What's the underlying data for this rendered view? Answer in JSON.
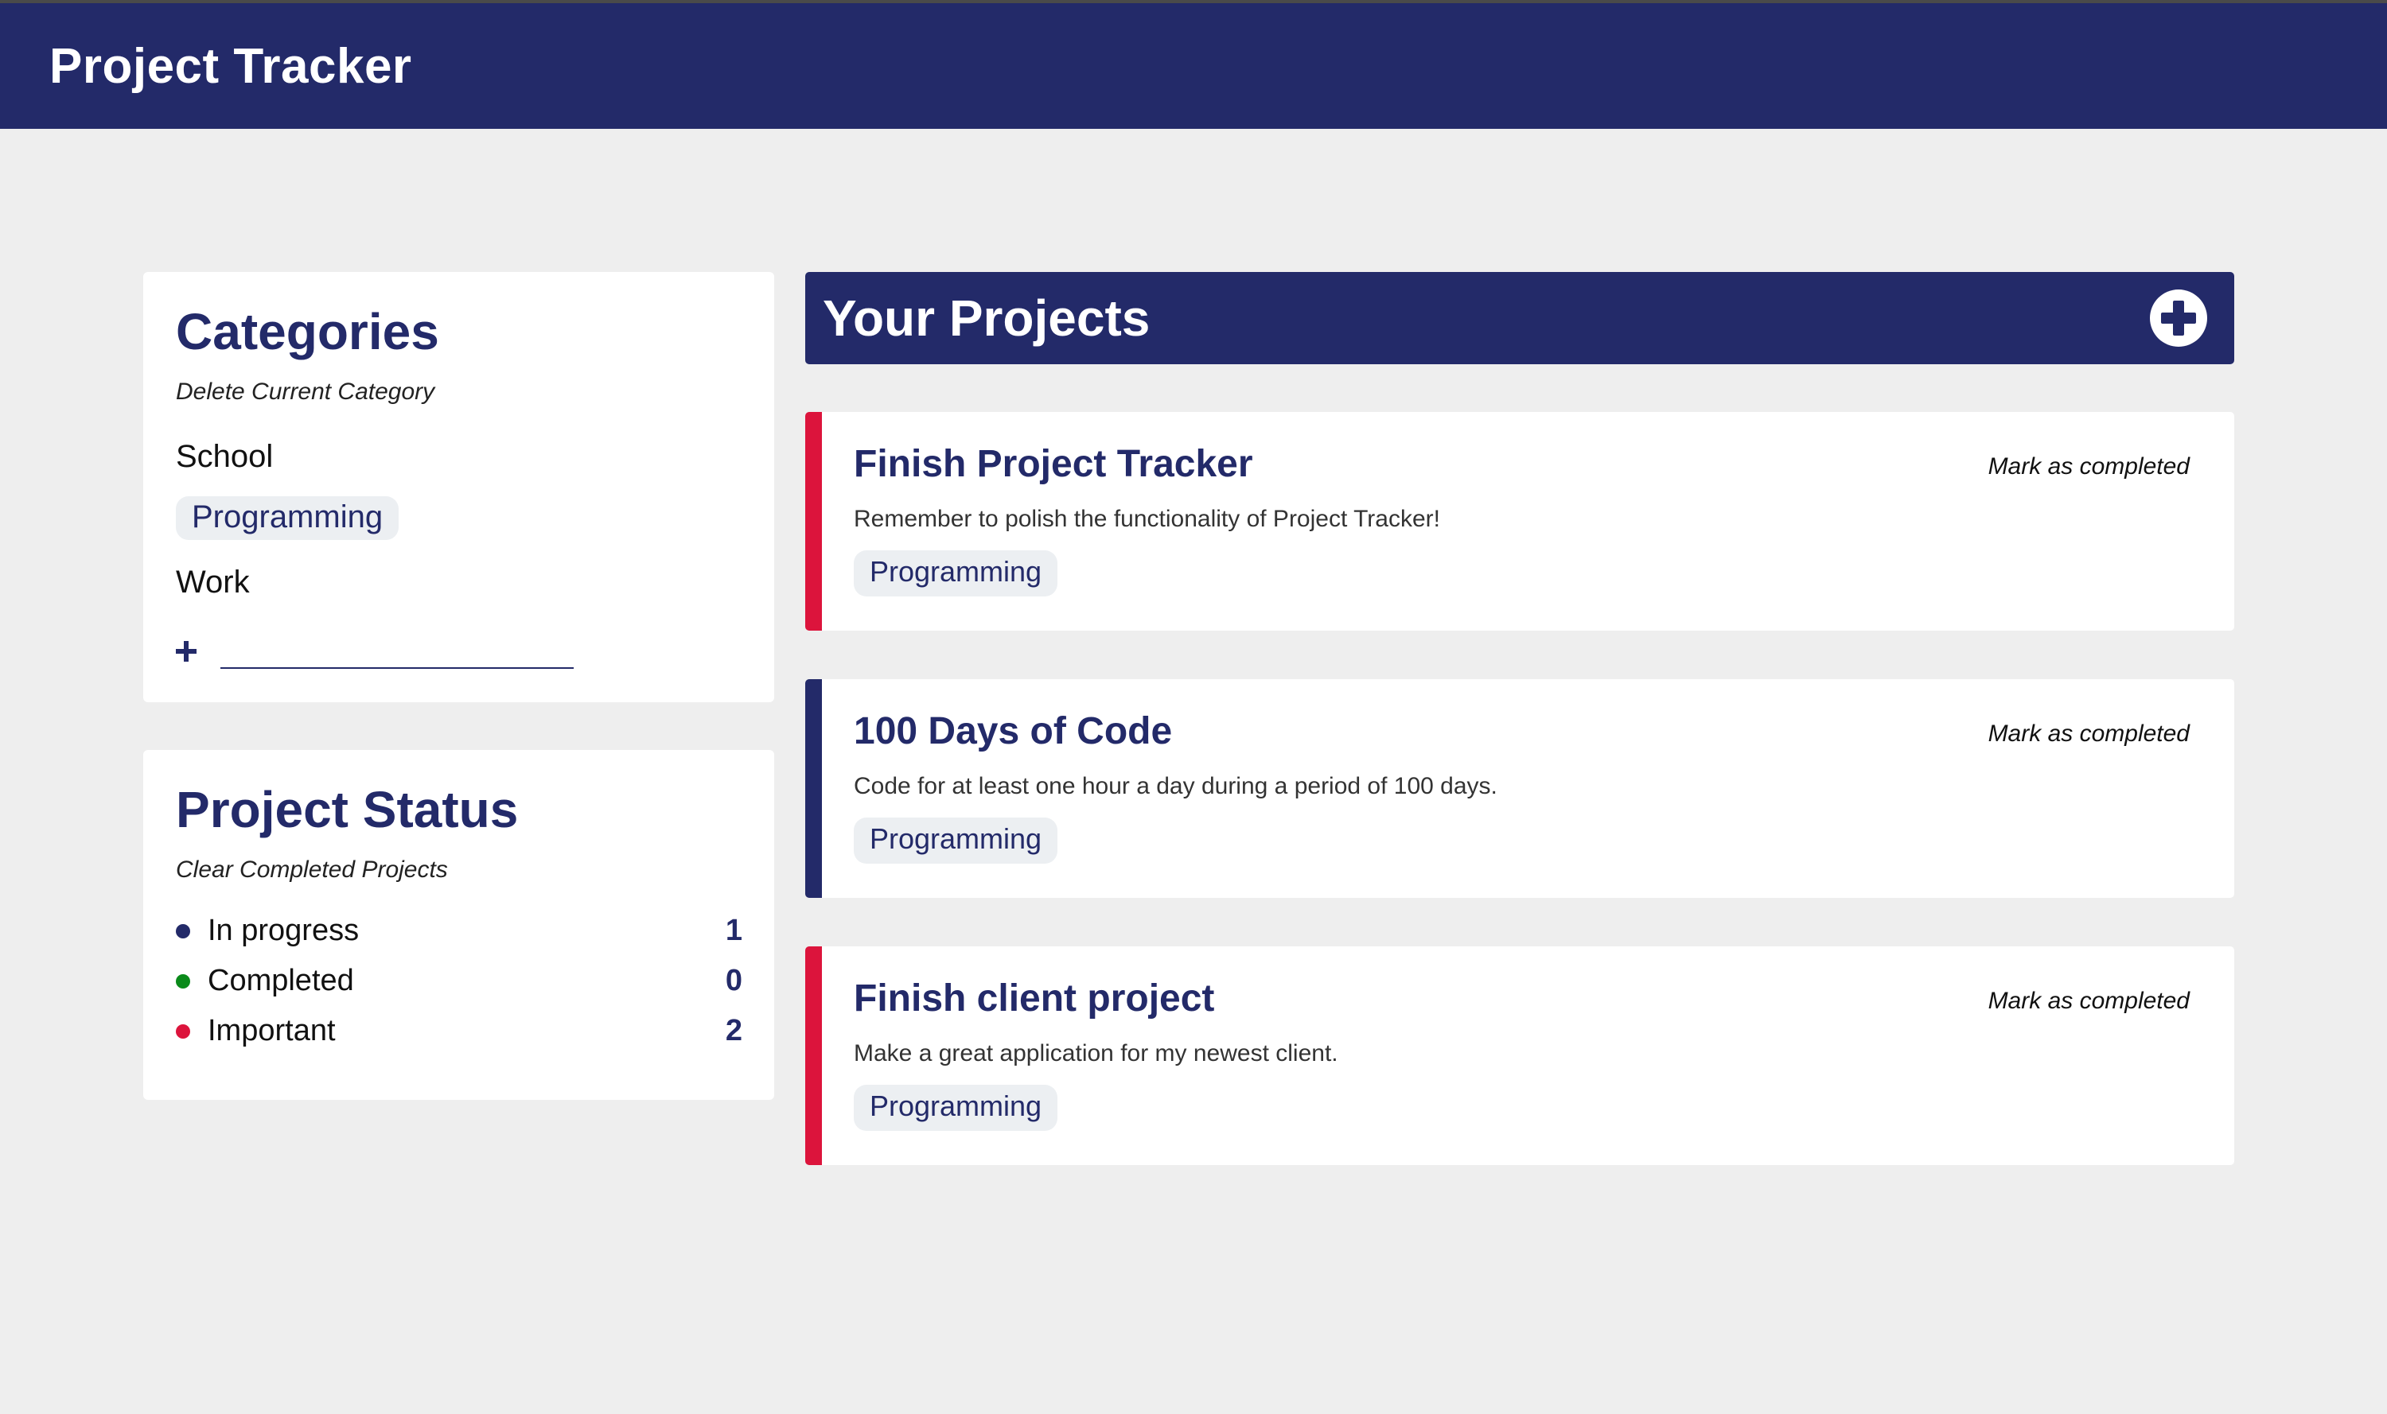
{
  "app": {
    "title": "Project Tracker"
  },
  "categories": {
    "heading": "Categories",
    "delete_label": "Delete Current Category",
    "items": [
      {
        "label": "School",
        "active": false
      },
      {
        "label": "Programming",
        "active": true
      },
      {
        "label": "Work",
        "active": false
      }
    ],
    "new_category_value": ""
  },
  "status": {
    "heading": "Project Status",
    "clear_label": "Clear Completed Projects",
    "rows": [
      {
        "label": "In progress",
        "count": "1",
        "color": "#232a69"
      },
      {
        "label": "Completed",
        "count": "0",
        "color": "#0a8a1a"
      },
      {
        "label": "Important",
        "count": "2",
        "color": "#dc143c"
      }
    ]
  },
  "projects": {
    "heading": "Your Projects",
    "add_icon": "plus-circle-icon",
    "items": [
      {
        "title": "Finish Project Tracker",
        "description": "Remember to polish the functionality of Project Tracker!",
        "tag": "Programming",
        "action": "Mark as completed",
        "important": true
      },
      {
        "title": "100 Days of Code",
        "description": "Code for at least one hour a day during a period of 100 days.",
        "tag": "Programming",
        "action": "Mark as completed",
        "important": false
      },
      {
        "title": "Finish client project",
        "description": "Make a great application for my newest client.",
        "tag": "Programming",
        "action": "Mark as completed",
        "important": true
      }
    ]
  },
  "colors": {
    "brand": "#232a69",
    "important": "#dc143c",
    "completed": "#0a8a1a",
    "background": "#eeeeee"
  }
}
